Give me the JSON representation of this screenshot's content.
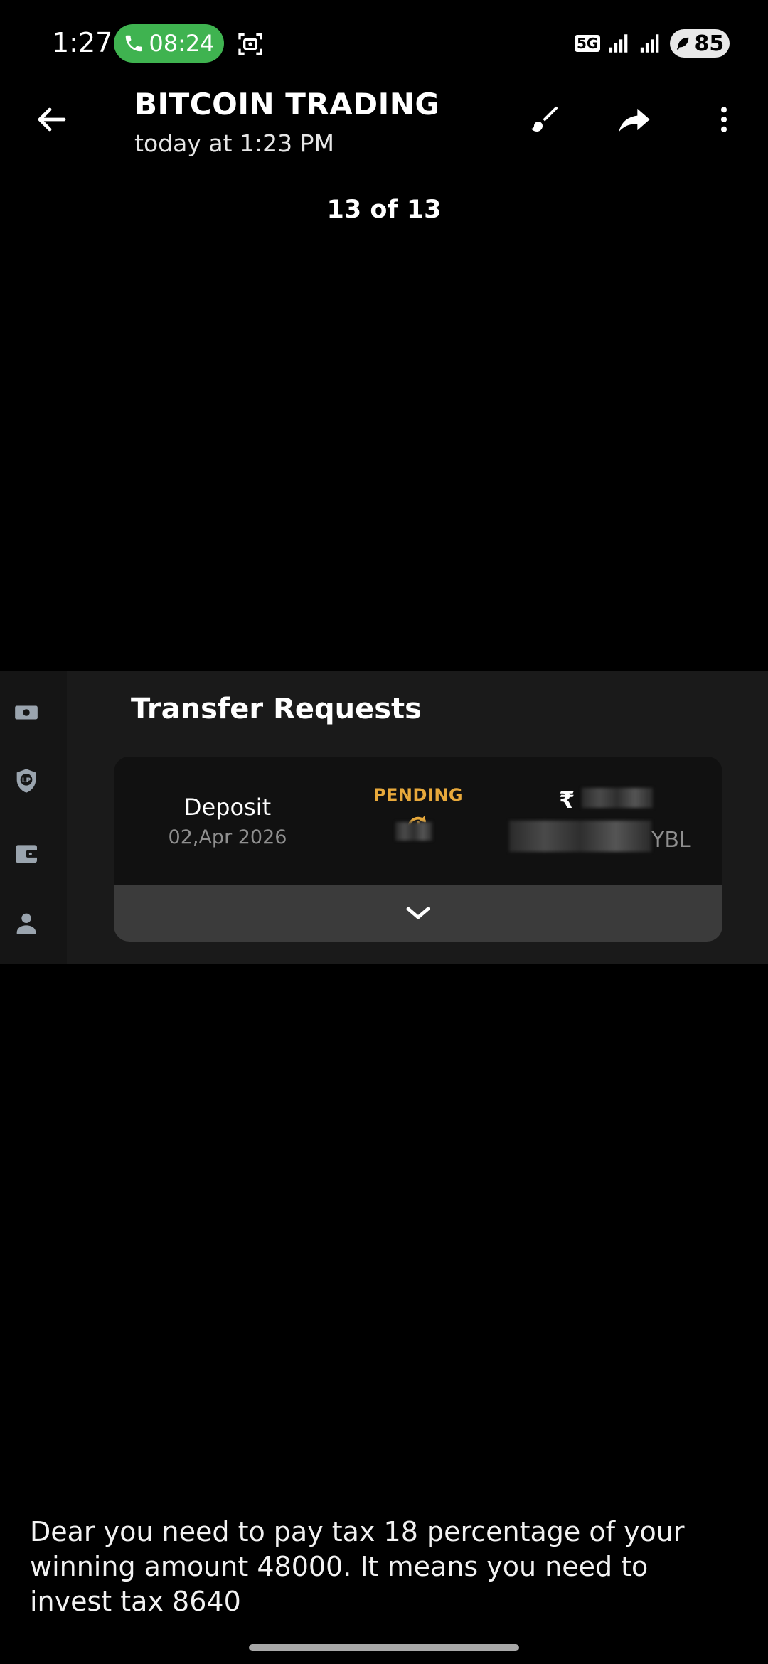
{
  "status_bar": {
    "time": "1:27",
    "call_timer": "08:24",
    "network": "5G",
    "battery": "85"
  },
  "header": {
    "title": "BITCOIN TRADING",
    "subtitle": "today at 1:23 PM"
  },
  "viewer": {
    "counter": "13 of 13"
  },
  "screenshot_panel": {
    "title": "Transfer Requests",
    "row": {
      "type": "Deposit",
      "date": "02,Apr 2026",
      "status": "PENDING",
      "currency_symbol": "₹",
      "account_suffix": "YBL"
    },
    "status_color": "#e8a93b"
  },
  "caption": {
    "text": "Dear you need to pay tax 18 percentage of your winning amount 48000. It means you need to invest tax 8640"
  },
  "icons": [
    "phone-icon",
    "screen-capture-icon",
    "signal-icon",
    "battery-leaf-icon",
    "back-arrow-icon",
    "brush-icon",
    "share-arrow-icon",
    "more-vert-icon",
    "money-icon",
    "shield-icon",
    "wallet-icon",
    "person-icon",
    "hourglass-icon",
    "chevron-down-icon"
  ]
}
